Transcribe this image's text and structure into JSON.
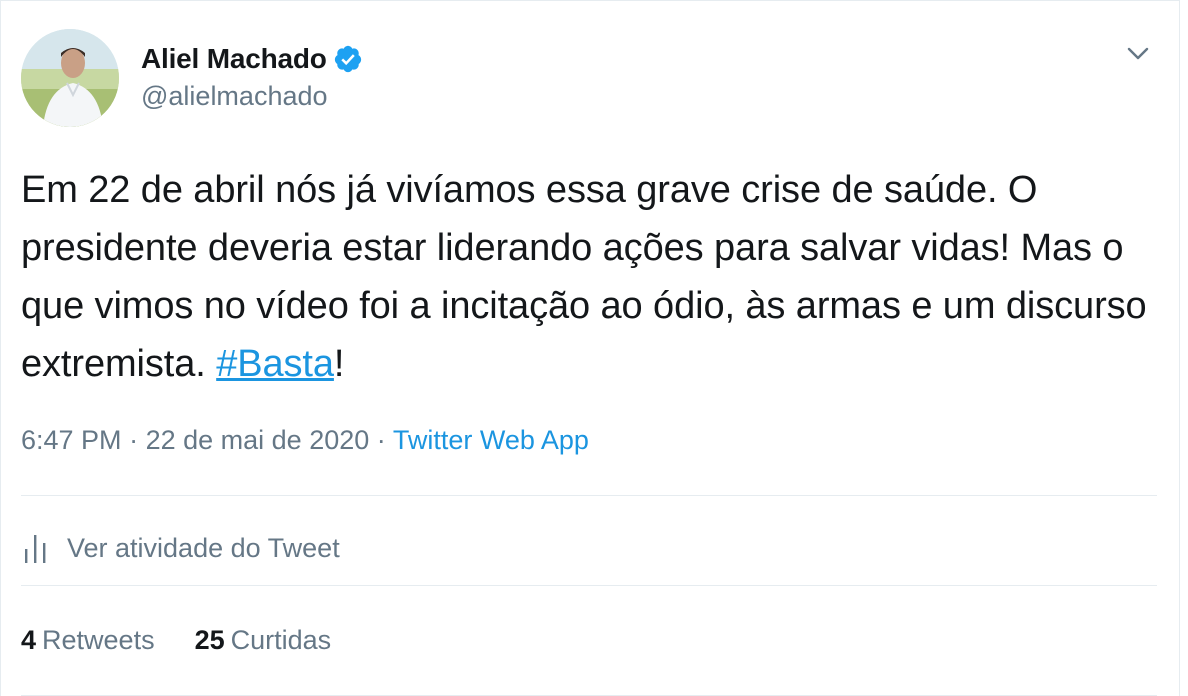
{
  "author": {
    "display_name": "Aliel Machado",
    "handle": "@alielmachado",
    "verified_icon": "verified-badge-icon",
    "avatar_icon": "profile-photo"
  },
  "tweet": {
    "text_before": "Em 22 de abril nós já vivíamos essa grave crise de saúde. O presidente deveria estar liderando ações para salvar vidas! Mas o que vimos no vídeo foi a incitação ao ódio, às armas e um discurso extremista. ",
    "hashtag": "#Basta",
    "text_after": "!"
  },
  "meta": {
    "time": "6:47 PM",
    "separator_1": "·",
    "date": "22 de mai de 2020",
    "separator_2": "·",
    "source": "Twitter Web App"
  },
  "activity": {
    "label": "Ver atividade do Tweet",
    "icon": "analytics-bars-icon"
  },
  "stats": {
    "retweets_count": "4",
    "retweets_label": "Retweets",
    "likes_count": "25",
    "likes_label": "Curtidas"
  },
  "colors": {
    "link": "#1b95e0",
    "secondary_text": "#657786",
    "primary_text": "#14171a",
    "divider": "#e6ecf0",
    "verified": "#1da1f2"
  }
}
